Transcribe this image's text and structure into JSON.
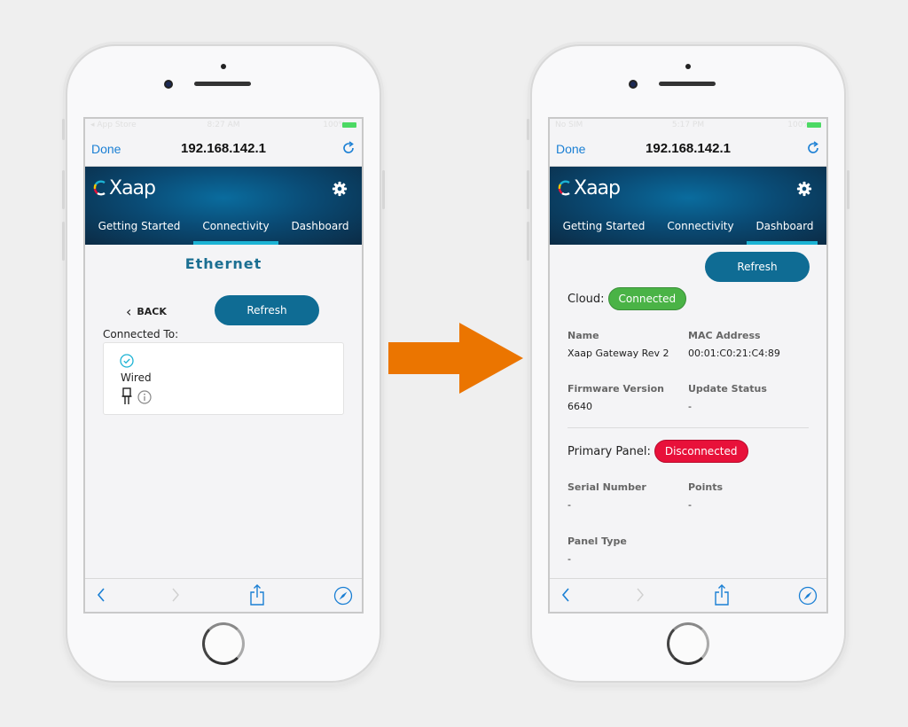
{
  "arrow": {
    "color": "#eb7500",
    "icon": "right-arrow-icon"
  },
  "colors": {
    "accent_blue": "#1a7fd4",
    "primary_button": "#0f6c94",
    "tab_indicator": "#1cb3d4",
    "connected_green": "#4ab346",
    "disconnected_red": "#e8113a",
    "title_teal": "#1b6f92"
  },
  "left_phone": {
    "status_bar": {
      "carrier": "◂ App Store",
      "time": "8:27 AM",
      "battery": "100%"
    },
    "browser": {
      "done_label": "Done",
      "url_title": "192.168.142.1",
      "reload_icon": "reload-icon"
    },
    "app": {
      "logo_text": "Xaap",
      "settings_icon": "gear-icon",
      "tabs": [
        {
          "label": "Getting Started",
          "active": false
        },
        {
          "label": "Connectivity",
          "active": true
        },
        {
          "label": "Dashboard",
          "active": false
        }
      ],
      "page_title": "Ethernet",
      "back_label": "BACK",
      "refresh_label": "Refresh",
      "connected_to_label": "Connected To:",
      "connection": {
        "status_icon": "check-circle-icon",
        "type": "Wired",
        "type_icon": "ethernet-plug-icon",
        "info_icon": "info-icon"
      }
    },
    "toolbar": [
      "back-icon",
      "forward-icon",
      "share-icon",
      "compass-icon"
    ]
  },
  "right_phone": {
    "status_bar": {
      "carrier": "No SIM",
      "time": "5:17 PM",
      "battery": "100%"
    },
    "browser": {
      "done_label": "Done",
      "url_title": "192.168.142.1",
      "reload_icon": "reload-icon"
    },
    "app": {
      "logo_text": "Xaap",
      "settings_icon": "gear-icon",
      "tabs": [
        {
          "label": "Getting Started",
          "active": false
        },
        {
          "label": "Connectivity",
          "active": false
        },
        {
          "label": "Dashboard",
          "active": true
        }
      ],
      "refresh_label": "Refresh",
      "cloud": {
        "label": "Cloud:",
        "status": "Connected"
      },
      "gateway": {
        "name_label": "Name",
        "name_value": "Xaap Gateway Rev 2",
        "mac_label": "MAC Address",
        "mac_value": "00:01:C0:21:C4:89",
        "firmware_label": "Firmware Version",
        "firmware_value": "6640",
        "update_label": "Update Status",
        "update_value": "-"
      },
      "primary_panel": {
        "label": "Primary Panel:",
        "status": "Disconnected"
      },
      "panel": {
        "serial_label": "Serial Number",
        "serial_value": "-",
        "points_label": "Points",
        "points_value": "-",
        "type_label": "Panel Type",
        "type_value": "-"
      }
    },
    "toolbar": [
      "back-icon",
      "forward-icon",
      "share-icon",
      "compass-icon"
    ]
  }
}
